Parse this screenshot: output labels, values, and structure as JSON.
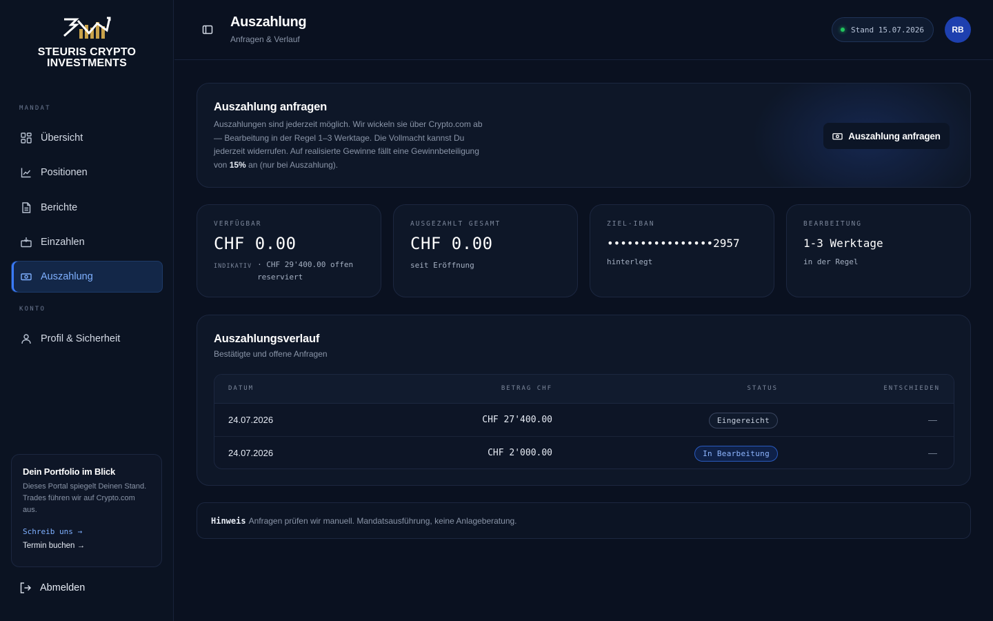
{
  "brand": {
    "name_line1": "STEURIS CRYPTO",
    "name_line2": "INVESTMENTS"
  },
  "sidebar": {
    "section_mandat": "MANDAT",
    "section_konto": "KONTO",
    "items": [
      {
        "label": "Übersicht",
        "icon": "grid-icon"
      },
      {
        "label": "Positionen",
        "icon": "chart-icon"
      },
      {
        "label": "Berichte",
        "icon": "document-icon"
      },
      {
        "label": "Einzahlen",
        "icon": "deposit-icon"
      },
      {
        "label": "Auszahlung",
        "icon": "banknote-icon",
        "active": true
      },
      {
        "label": "Profil & Sicherheit",
        "icon": "user-icon"
      }
    ],
    "promo": {
      "title": "Dein Portfolio im Blick",
      "text": "Dieses Portal spiegelt Deinen Stand. Trades führen wir auf Crypto.com aus.",
      "link_write": "Schreib uns →",
      "link_book": "Termin buchen →"
    },
    "logout": "Abmelden"
  },
  "header": {
    "title": "Auszahlung",
    "subtitle": "Anfragen & Verlauf",
    "stand": "Stand 15.07.2026",
    "avatar": "RB"
  },
  "request": {
    "title": "Auszahlung anfragen",
    "text_before": "Auszahlungen sind jederzeit möglich. Wir wickeln sie über Crypto.com ab — Bearbeitung in der Regel 1–3 Werktage. Die Vollmacht kannst Du jederzeit widerrufen. Auf realisierte Gewinne fällt eine Gewinnbeteiligung von ",
    "text_bold": "15%",
    "text_after": " an (nur bei Auszahlung).",
    "button": "Auszahlung anfragen"
  },
  "stats": {
    "available": {
      "label": "VERFÜGBAR",
      "value": "CHF 0.00",
      "tag": "INDIKATIV",
      "note": "· CHF 29'400.00 offen reserviert"
    },
    "paid": {
      "label": "AUSGEZAHLT GESAMT",
      "value": "CHF 0.00",
      "sub": "seit Eröffnung"
    },
    "iban": {
      "label": "ZIEL-IBAN",
      "value": "••••••••••••••••2957",
      "sub": "hinterlegt"
    },
    "processing": {
      "label": "BEARBEITUNG",
      "value": "1-3 Werktage",
      "sub": "in der Regel"
    }
  },
  "history": {
    "title": "Auszahlungsverlauf",
    "subtitle": "Bestätigte und offene Anfragen",
    "columns": {
      "date": "DATUM",
      "amount": "BETRAG CHF",
      "status": "STATUS",
      "decided": "ENTSCHIEDEN"
    },
    "rows": [
      {
        "date": "24.07.2026",
        "amount": "CHF 27'400.00",
        "status": "Eingereicht",
        "decided": "—"
      },
      {
        "date": "24.07.2026",
        "amount": "CHF 2'000.00",
        "status": "In Bearbeitung",
        "decided": "—"
      }
    ]
  },
  "note": {
    "label": "Hinweis",
    "text": "Anfragen prüfen wir manuell. Mandatsausführung, keine Anlageberatung."
  }
}
